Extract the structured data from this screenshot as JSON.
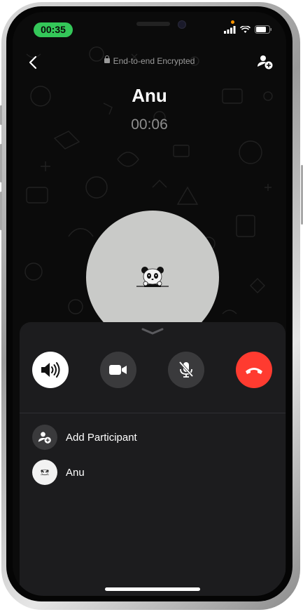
{
  "status": {
    "time": "00:35"
  },
  "header": {
    "encryption": "End-to-end Encrypted"
  },
  "call": {
    "name": "Anu",
    "duration": "00:06"
  },
  "controls": [
    {
      "name": "speaker",
      "icon": "speaker-icon",
      "active": true
    },
    {
      "name": "video",
      "icon": "video-icon",
      "active": false
    },
    {
      "name": "mute",
      "icon": "mic-off-icon",
      "active": false
    },
    {
      "name": "end-call",
      "icon": "phone-hangup-icon",
      "color": "#ff3b30"
    }
  ],
  "participants": {
    "add_label": "Add Participant",
    "items": [
      {
        "name": "Anu"
      }
    ]
  },
  "colors": {
    "accent_green": "#34c759",
    "end_red": "#ff3b30",
    "sheet": "#1c1c1e"
  }
}
